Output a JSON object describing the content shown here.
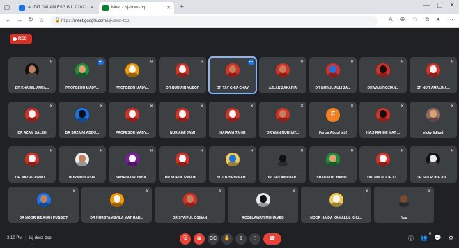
{
  "browser": {
    "tabs": [
      {
        "title": "AUDIT DALAM FSG BIL 1/2021",
        "favicon_color": "#1a73e8"
      },
      {
        "title": "Meet - isj-drwz-zcp",
        "favicon_color": "#00832d"
      }
    ],
    "url_prefix": "https://",
    "url_host": "meet.google.com",
    "url_path": "/isj-drwz-zcp"
  },
  "meeting": {
    "rec_label": "REC",
    "time": "3:10 PM",
    "code": "isj-drwz-zcp",
    "participant_count": "6"
  },
  "participants": [
    [
      {
        "name": "DR KHAIRIL ANUA...",
        "color": "#111111",
        "skin": "#c08060",
        "speaking": false
      },
      {
        "name": "PROFESOR MADY...",
        "color": "#1e8e3e",
        "skin": "#e0a070",
        "speaking": true
      },
      {
        "name": "PROFESOR MADY...",
        "color": "#f29900",
        "skin": "#f5f5f5",
        "speaking": false
      },
      {
        "name": "DR NUR'AIN YUSOF",
        "color": "#d93025",
        "skin": "#f5f5f5",
        "speaking": false
      },
      {
        "name": "DR TAY CHIA CHAY",
        "color": "#d93025",
        "skin": "#c08060",
        "speaking": true,
        "active": true
      },
      {
        "name": "AZLAN ZAKARIA",
        "color": "#d93025",
        "skin": "#c08060",
        "speaking": false
      },
      {
        "name": "DR NURUL AULI ZA...",
        "color": "#d93025",
        "skin": "#1a73e8",
        "speaking": false
      },
      {
        "name": "DR WAN ROZIAN...",
        "color": "#d93025",
        "skin": "#111111",
        "speaking": false
      },
      {
        "name": "DR NUR AMALINA...",
        "color": "#d93025",
        "skin": "#f5f5f5",
        "speaking": false
      }
    ],
    [
      {
        "name": "DR AZAM SALEH",
        "color": "#d93025",
        "skin": "#f5f5f5",
        "speaking": false
      },
      {
        "name": "DR SUZAINI ABDU...",
        "color": "#1a73e8",
        "skin": "#111111",
        "speaking": false
      },
      {
        "name": "PROFESOR MADY...",
        "color": "#d93025",
        "skin": "#f5f5f5",
        "speaking": false
      },
      {
        "name": "NUR AIMI JAMI",
        "color": "#d93025",
        "skin": "#f5f5f5",
        "speaking": false
      },
      {
        "name": "HAIRANI TAHIR",
        "color": "#d93025",
        "skin": "#f5f5f5",
        "speaking": false
      },
      {
        "name": "DR WAN NURHAY...",
        "color": "#d93025",
        "skin": "#c08060",
        "speaking": false
      },
      {
        "name": "Fariza Abdul latif",
        "color": "#f4811f",
        "letter": "F",
        "speaking": false
      },
      {
        "name": "HAJI RAHIMI MAT ...",
        "color": "#d93025",
        "skin": "#111111",
        "speaking": false
      },
      {
        "name": "vicky lidhud",
        "color": "#8d6e63",
        "skin": "#e0a070",
        "speaking": false
      }
    ],
    [
      {
        "name": "DR NAZRIZAWATI ...",
        "color": "#d93025",
        "skin": "#f5f5f5",
        "speaking": false
      },
      {
        "name": "NORAINI KASIM",
        "color": "#e8eaed",
        "skin": "#c08060",
        "speaking": false
      },
      {
        "name": "SABRINA W YAHA...",
        "color": "#7b1fa2",
        "skin": "#f5f5f5",
        "speaking": false
      },
      {
        "name": "DR NURUL IZWANI ...",
        "color": "#d93025",
        "skin": "#f5f5f5",
        "speaking": false
      },
      {
        "name": "SITI TUSRINA AH...",
        "color": "#f2c94c",
        "skin": "#1a73e8",
        "speaking": false
      },
      {
        "name": "DR. SITI AINI DAR...",
        "color": "#3c4043",
        "skin": "#111111",
        "speaking": false
      },
      {
        "name": "SHADATUL HANO...",
        "color": "#1e8e3e",
        "skin": "#e0a070",
        "speaking": false
      },
      {
        "name": "DR. NIK NOOR ID...",
        "color": "#d93025",
        "skin": "#f5f5f5",
        "speaking": false
      },
      {
        "name": "DR SITI ROHA AB ...",
        "color": "#111111",
        "skin": "#e8eaed",
        "speaking": false
      }
    ]
  ],
  "participants_bottom": [
    {
      "name": "DR NOOR HIDAYAH PUNGOT",
      "color": "#1a73e8",
      "skin": "#c08060"
    },
    {
      "name": "DR NURSYAMSYILA MAT HAD...",
      "color": "#f29900",
      "skin": "#f5f5f5"
    },
    {
      "name": "DR SYAIFUL OSMAN",
      "color": "#d93025",
      "skin": "#c08060"
    },
    {
      "name": "ROSELAWATI MOHAMED",
      "color": "#e8eaed",
      "skin": "#111111"
    },
    {
      "name": "NOOR HAIDA KAMALUL KHU...",
      "color": "#f2c94c",
      "skin": "#f5f5f5"
    },
    {
      "name": "You",
      "color": "#3c4043",
      "skin": "#7b4b2a"
    }
  ]
}
